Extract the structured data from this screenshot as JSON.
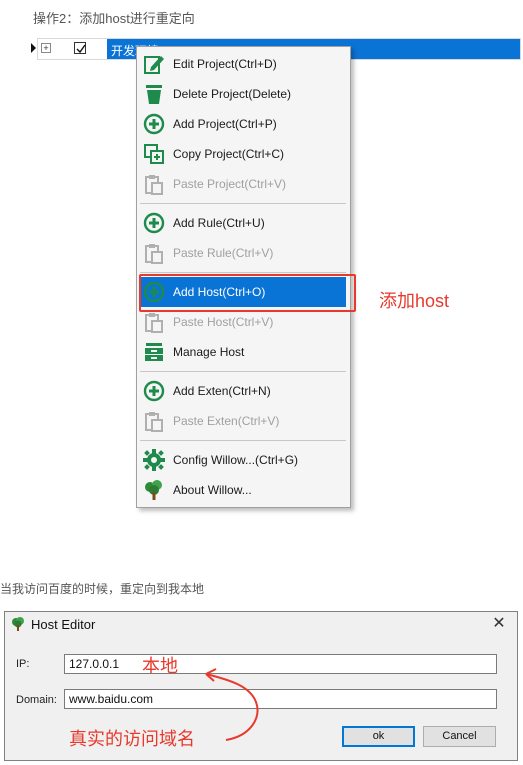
{
  "captions": {
    "step2": "操作2：添加host进行重定向",
    "redirect_note": "当我访问百度的时候，重定向到我本地"
  },
  "tree": {
    "project_label": "开发环境",
    "checked": true
  },
  "menu": {
    "items": [
      {
        "label": "Edit Project(Ctrl+D)",
        "icon": "edit-icon",
        "enabled": true
      },
      {
        "label": "Delete Project(Delete)",
        "icon": "trash-icon",
        "enabled": true
      },
      {
        "label": "Add Project(Ctrl+P)",
        "icon": "add-circle-icon",
        "enabled": true
      },
      {
        "label": "Copy Project(Ctrl+C)",
        "icon": "copy-icon",
        "enabled": true
      },
      {
        "label": "Paste Project(Ctrl+V)",
        "icon": "paste-icon",
        "enabled": false
      },
      {
        "label": "Add Rule(Ctrl+U)",
        "icon": "add-circle-icon",
        "enabled": true
      },
      {
        "label": "Paste Rule(Ctrl+V)",
        "icon": "paste-icon",
        "enabled": false
      },
      {
        "label": "Add Host(Ctrl+O)",
        "icon": "add-circle-icon",
        "enabled": true,
        "highlighted": true
      },
      {
        "label": "Paste Host(Ctrl+V)",
        "icon": "paste-icon",
        "enabled": false
      },
      {
        "label": "Manage Host",
        "icon": "server-icon",
        "enabled": true
      },
      {
        "label": "Add Exten(Ctrl+N)",
        "icon": "add-circle-icon",
        "enabled": true
      },
      {
        "label": "Paste Exten(Ctrl+V)",
        "icon": "paste-icon",
        "enabled": false
      },
      {
        "label": "Config Willow...(Ctrl+G)",
        "icon": "gear-icon",
        "enabled": true
      },
      {
        "label": "About Willow...",
        "icon": "tree-icon",
        "enabled": true
      }
    ]
  },
  "annotations": {
    "add_host": "添加host",
    "local": "本地",
    "real_domain": "真实的访问域名"
  },
  "host_editor": {
    "title": "Host Editor",
    "ip_label": "IP:",
    "ip_value": "127.0.0.1",
    "domain_label": "Domain:",
    "domain_value": "www.baidu.com",
    "ok_label": "ok",
    "cancel_label": "Cancel"
  },
  "colors": {
    "icon_green": "#1e8a4c",
    "selection_blue": "#0a74d6",
    "annotation_red": "#e8392c"
  }
}
